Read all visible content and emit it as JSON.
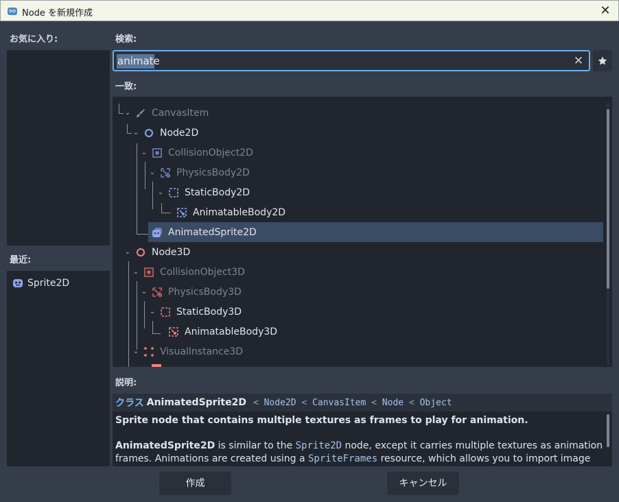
{
  "window": {
    "title": "Node を新規作成",
    "close_label": "✕"
  },
  "favorites": {
    "label": "お気に入り:"
  },
  "recent": {
    "label": "最近:",
    "items": [
      {
        "label": "Sprite2D"
      }
    ]
  },
  "search": {
    "label": "検索:",
    "value": "animate"
  },
  "matches": {
    "label": "一致:",
    "tree": [
      {
        "label": "CanvasItem",
        "icon": "brush-icon",
        "dim": true
      },
      {
        "label": "Node2D",
        "icon": "node2d-icon",
        "dim": false
      },
      {
        "label": "CollisionObject2D",
        "icon": "collision-object-2d-icon",
        "dim": true
      },
      {
        "label": "PhysicsBody2D",
        "icon": "physics-body-2d-icon",
        "dim": true
      },
      {
        "label": "StaticBody2D",
        "icon": "static-body-2d-icon",
        "dim": false
      },
      {
        "label": "AnimatableBody2D",
        "icon": "animatable-body-2d-icon",
        "dim": false
      },
      {
        "label": "AnimatedSprite2D",
        "icon": "animated-sprite-2d-icon",
        "dim": false,
        "selected": true
      },
      {
        "label": "Node3D",
        "icon": "node3d-icon",
        "dim": false
      },
      {
        "label": "CollisionObject3D",
        "icon": "collision-object-3d-icon",
        "dim": true
      },
      {
        "label": "PhysicsBody3D",
        "icon": "physics-body-3d-icon",
        "dim": true
      },
      {
        "label": "StaticBody3D",
        "icon": "static-body-3d-icon",
        "dim": false
      },
      {
        "label": "AnimatableBody3D",
        "icon": "animatable-body-3d-icon",
        "dim": false
      },
      {
        "label": "VisualInstance3D",
        "icon": "visual-instance-3d-icon",
        "dim": true
      }
    ]
  },
  "description": {
    "label": "説明:",
    "class_word": "クラス",
    "class_name": "AnimatedSprite2D",
    "inheritance": [
      "Node2D",
      "CanvasItem",
      "Node",
      "Object"
    ],
    "sep": "<",
    "summary": "Sprite node that contains multiple textures as frames to play for animation.",
    "body_name": "AnimatedSprite2D",
    "body_1": " is similar to the ",
    "body_code_1": "Sprite2D",
    "body_2": " node, except it carries multiple textures as animation frames. Animations are created using a ",
    "body_code_2": "SpriteFrames",
    "body_3": " resource, which allows you to import image files"
  },
  "buttons": {
    "create": "作成",
    "cancel": "キャンセル"
  },
  "colors": {
    "accent": "#6ab0f0",
    "icon_2d": "#8da5f3",
    "icon_3d": "#fc7f7f",
    "selected_row": "#3a4c63"
  }
}
